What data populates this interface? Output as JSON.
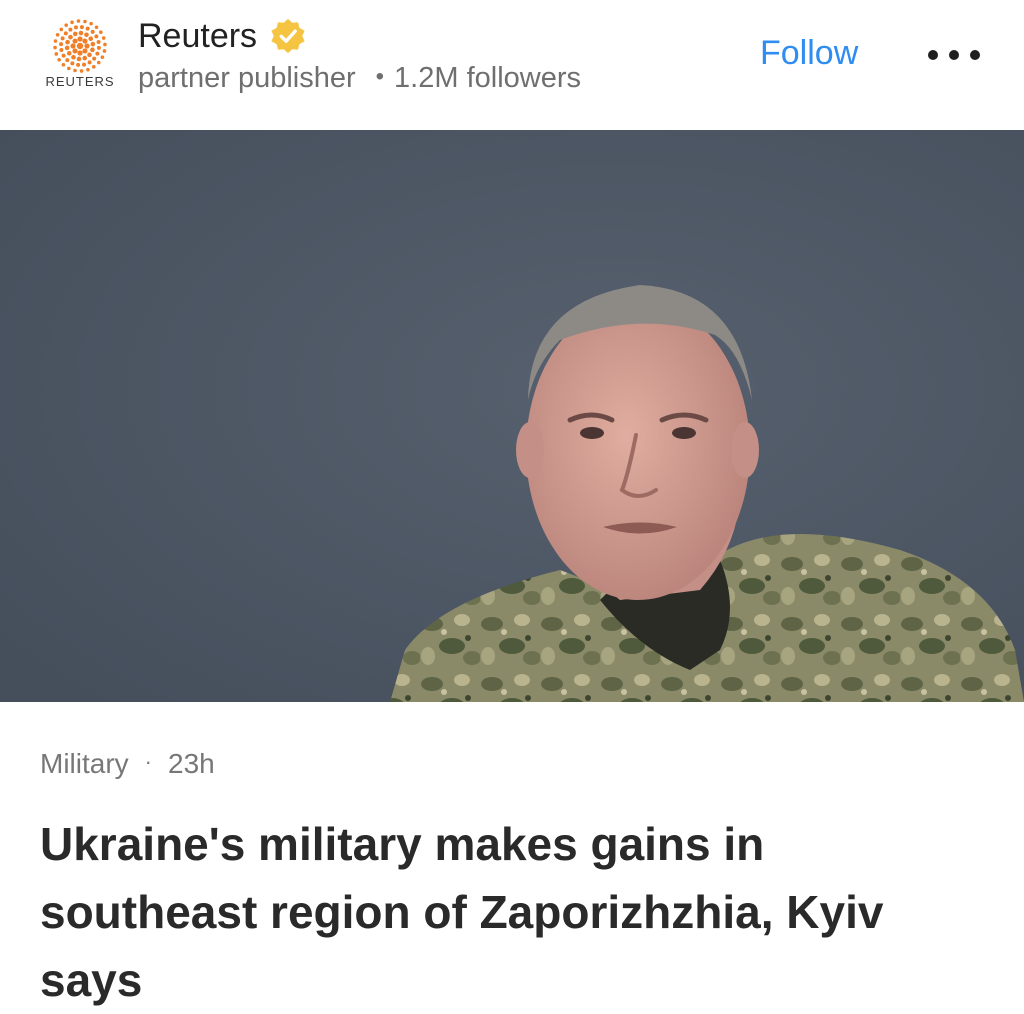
{
  "publisher": {
    "name": "Reuters",
    "logo_text": "REUTERS",
    "verified_icon": "verified-badge-icon",
    "role": "partner publisher",
    "followers": "1.2M followers",
    "follow_label": "Follow",
    "more_icon": "more-options-icon"
  },
  "article": {
    "image_alt": "Ukrainian military officer in camouflage uniform",
    "category": "Military",
    "age": "23h",
    "headline": "Ukraine's military makes gains in southeast region of Zaporizhzhia, Kyiv says"
  },
  "colors": {
    "follow": "#2f8cf0",
    "logo_orange": "#f07f2a",
    "verified_gold": "#f5c542"
  }
}
